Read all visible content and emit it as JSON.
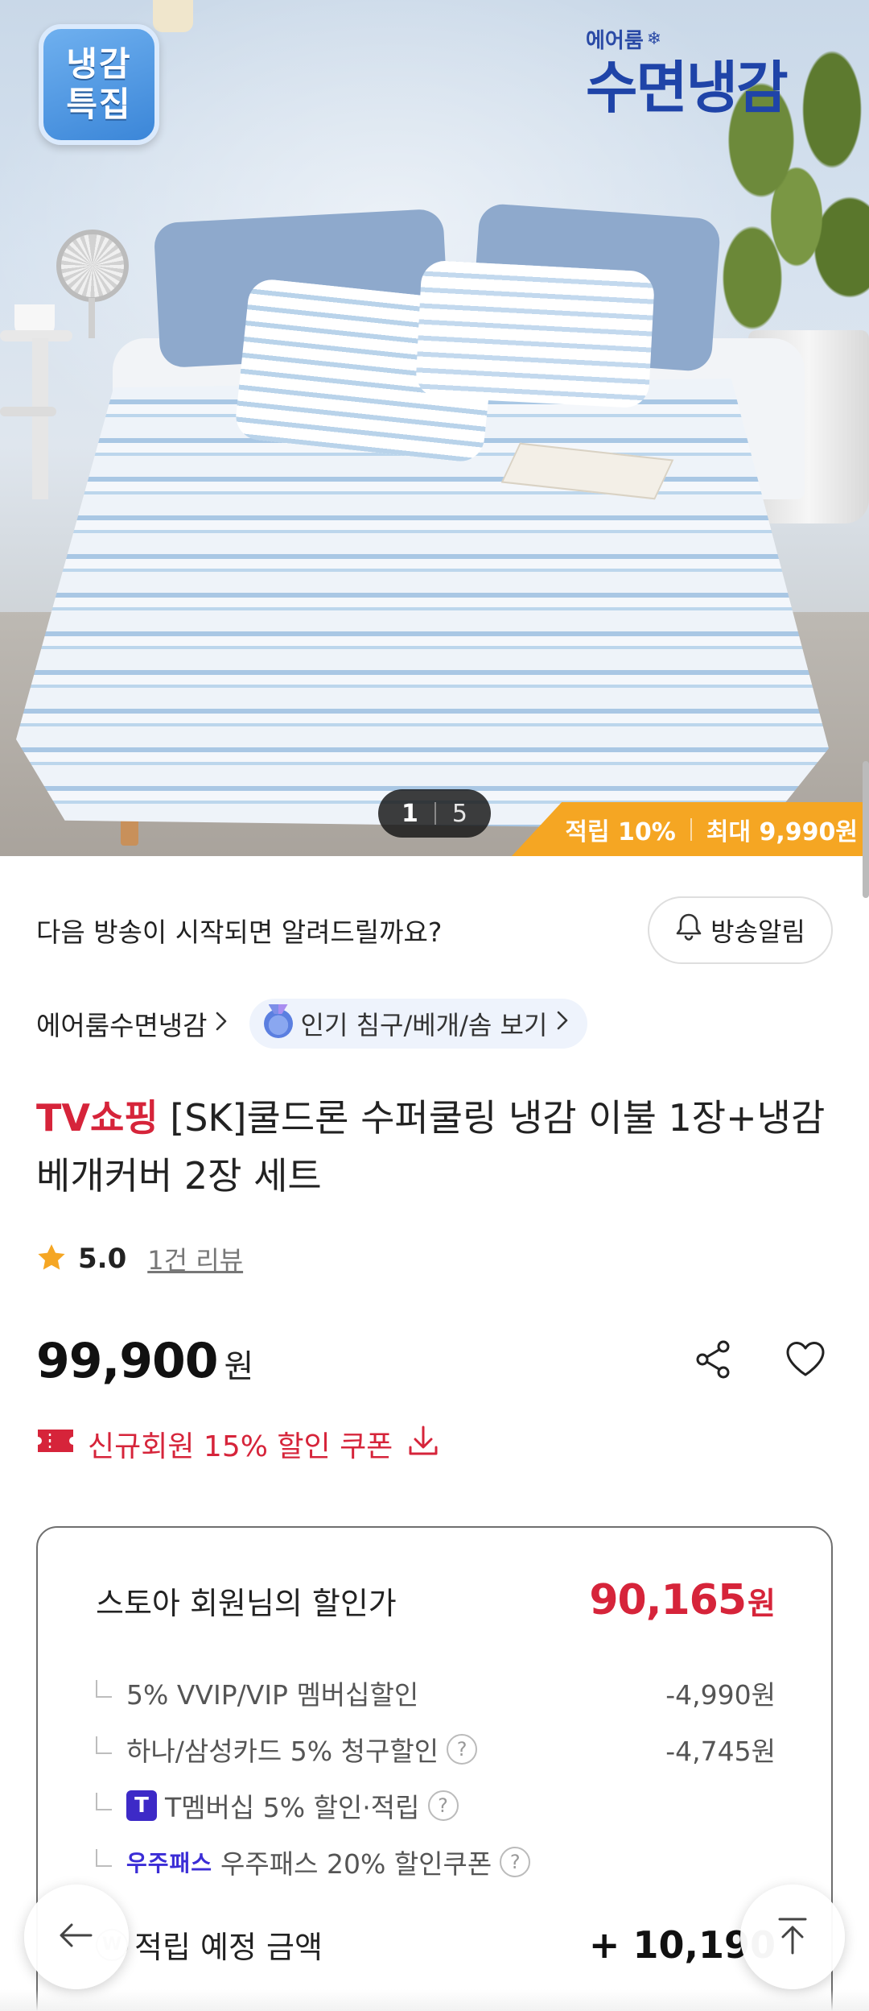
{
  "hero": {
    "badge_line1": "냉감",
    "badge_line2": "특집",
    "brand_small": "에어룸",
    "brand_big": "수면냉감",
    "pager_current": "1",
    "pager_total": "5",
    "reward_rate": "적립 10%",
    "reward_max": "최대 9,990원"
  },
  "notify": {
    "text": "다음 방송이 시작되면 알려드릴까요?",
    "button_label": "방송알림"
  },
  "category": {
    "brand_link": "에어룸수면냉감",
    "pill_label": "인기 침구/베개/솜 보기"
  },
  "product": {
    "channel": "TV쇼핑",
    "name": "[SK]쿨드론 수퍼쿨링 냉감 이불 1장+냉감 베개커버 2장 세트",
    "rating": "5.0",
    "review_count": "1건 리뷰",
    "price": "99,900",
    "price_unit": "원",
    "coupon_text": "신규회원 15% 할인 쿠폰"
  },
  "discount_card": {
    "label": "스토아 회원님의 할인가",
    "price": "90,165",
    "price_unit": "원",
    "rows": [
      {
        "label": "5% VVIP/VIP 멤버십할인",
        "amount": "-4,990원"
      },
      {
        "label": "하나/삼성카드 5% 청구할인",
        "amount": "-4,745원"
      },
      {
        "label": "T멤버십 5% 할인·적립",
        "amount": ""
      },
      {
        "label": "우주패스 20% 할인쿠폰",
        "amount": ""
      }
    ],
    "t_badge": "T",
    "uzu_logo": "우주패스",
    "points_label": "적립 예정 금액",
    "points_value": "+ 10,190",
    "w_icon": "W"
  },
  "colors": {
    "accent_red": "#d6243a",
    "reward_orange": "#f5a623",
    "badge_blue": "#3b86d8",
    "brand_navy": "#1f44a8"
  },
  "icons": [
    "bell-icon",
    "chevron-right-icon",
    "medal-icon",
    "star-icon",
    "share-icon",
    "heart-icon",
    "coupon-ticket-icon",
    "download-icon",
    "help-icon",
    "arrow-left-icon",
    "arrow-up-icon"
  ]
}
